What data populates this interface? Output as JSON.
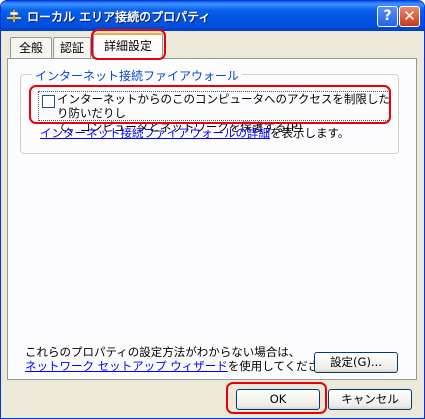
{
  "window": {
    "title": "ローカル エリア接続のプロパティ",
    "help_label": "?",
    "close_label": "✕"
  },
  "tabs": [
    {
      "label": "全般",
      "active": false
    },
    {
      "label": "認証",
      "active": false
    },
    {
      "label": "詳細設定",
      "active": true
    }
  ],
  "firewall": {
    "group_title": "インターネット接続ファイアウォール",
    "checkbox_line1": "インターネットからのこのコンピュータへのアクセスを制限したり防いだりし",
    "checkbox_line2": "て、コンピュータとネットワークを保護する(P)",
    "checkbox_checked": false,
    "details_link": "インターネット接続ファイアウォールの詳細",
    "details_suffix": "を表示します。"
  },
  "help": {
    "line1": "これらのプロパティの設定方法がわからない場合は、",
    "wizard_link": "ネットワーク セットアップ ウィザード",
    "line2_suffix": "を使用してください。"
  },
  "buttons": {
    "settings": "設定(G)...",
    "ok": "OK",
    "cancel": "キャンセル"
  },
  "highlight_color": "#e8000b"
}
